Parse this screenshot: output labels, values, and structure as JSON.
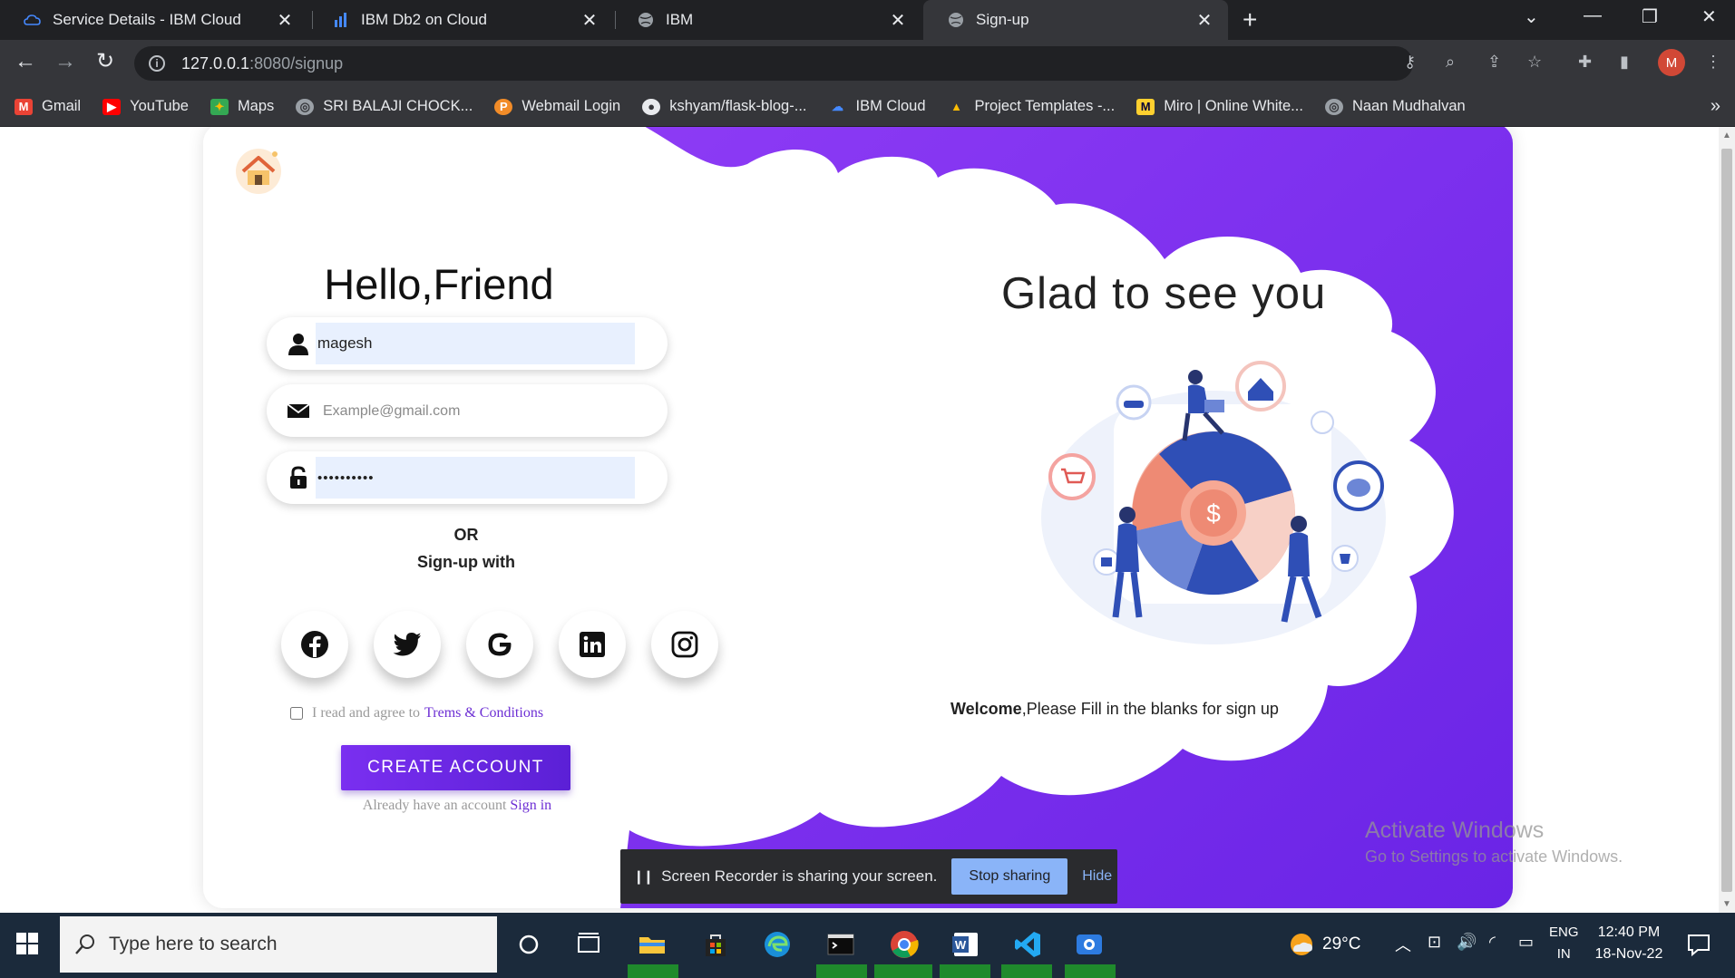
{
  "browser": {
    "tabs": [
      {
        "title": "Service Details - IBM Cloud",
        "active": false
      },
      {
        "title": "IBM Db2 on Cloud",
        "active": false
      },
      {
        "title": "IBM",
        "active": false
      },
      {
        "title": "Sign-up",
        "active": true
      }
    ],
    "url_host": "127.0.0.1",
    "url_rest": ":8080/signup",
    "profile_initial": "M",
    "bookmarks": [
      {
        "label": "Gmail",
        "icon": "gmail-icon"
      },
      {
        "label": "YouTube",
        "icon": "youtube-icon"
      },
      {
        "label": "Maps",
        "icon": "maps-icon"
      },
      {
        "label": "SRI BALAJI CHOCK...",
        "icon": "globe-icon"
      },
      {
        "label": "Webmail Login",
        "icon": "webmail-icon"
      },
      {
        "label": "kshyam/flask-blog-...",
        "icon": "github-icon"
      },
      {
        "label": "IBM Cloud",
        "icon": "ibm-cloud-icon"
      },
      {
        "label": "Project Templates -...",
        "icon": "drive-icon"
      },
      {
        "label": "Miro | Online White...",
        "icon": "miro-icon"
      },
      {
        "label": "Naan Mudhalvan",
        "icon": "globe-icon"
      }
    ]
  },
  "page": {
    "heading": "Hello,Friend",
    "username_value": "magesh",
    "email_placeholder": "Example@gmail.com",
    "password_value": "••••••••••",
    "or_text": "OR",
    "signup_with": "Sign-up with",
    "social": [
      "facebook",
      "twitter",
      "google",
      "linkedin",
      "instagram"
    ],
    "terms_prefix": "I read and agree to",
    "terms_link": "Trems & Conditions",
    "create_button": "CREATE ACCOUNT",
    "already_text": "Already have an account",
    "sign_in_link": "Sign in",
    "glad": "Glad to see you",
    "welcome_bold": "Welcome",
    "welcome_rest": ",Please Fill in the blanks for sign up",
    "colors": {
      "accent": "#7a2ff0",
      "link": "#6d2fd4",
      "purple_bg": "#7b2ff2"
    }
  },
  "overlay": {
    "activate_title": "Activate Windows",
    "activate_sub": "Go to Settings to activate Windows.",
    "recorder_text": "Screen Recorder is sharing your screen.",
    "stop_label": "Stop sharing",
    "hide_label": "Hide"
  },
  "taskbar": {
    "search_placeholder": "Type here to search",
    "temperature": "29°C",
    "lang1": "ENG",
    "lang2": "IN",
    "time": "12:40 PM",
    "date": "18-Nov-22"
  }
}
